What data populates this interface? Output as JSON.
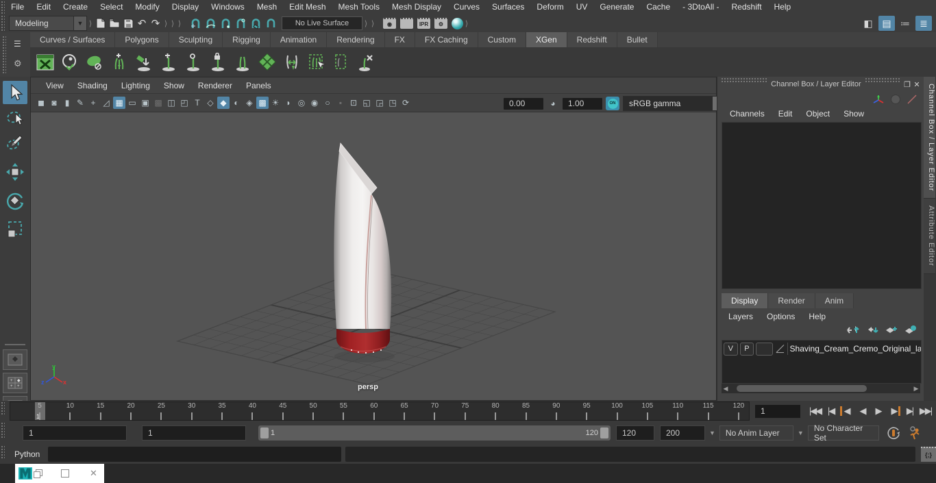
{
  "menubar": {
    "items": [
      "File",
      "Edit",
      "Create",
      "Select",
      "Modify",
      "Display",
      "Windows",
      "Mesh",
      "Edit Mesh",
      "Mesh Tools",
      "Mesh Display",
      "Curves",
      "Surfaces",
      "Deform",
      "UV",
      "Generate",
      "Cache",
      "- 3DtoAll -",
      "Redshift",
      "Help"
    ]
  },
  "statusline": {
    "mode": "Modeling",
    "live_surface": "No Live Surface",
    "undo_glyph": "↶",
    "redo_glyph": "↷",
    "collapse_glyph": "⟩",
    "ipr_label": "IPR",
    "workspace_buttons": [
      {
        "name": "modeling-toolkit-toggle-button",
        "g": "◧"
      },
      {
        "name": "attribute-editor-toggle-button",
        "g": "▤",
        "active": true
      },
      {
        "name": "tool-settings-toggle-button",
        "g": "≔"
      },
      {
        "name": "channel-box-toggle-button",
        "g": "≣",
        "active": true
      }
    ]
  },
  "shelf": {
    "tabs": [
      {
        "label": "Curves / Surfaces",
        "name": "shelf-tab-curves-surfaces"
      },
      {
        "label": "Polygons",
        "name": "shelf-tab-polygons"
      },
      {
        "label": "Sculpting",
        "name": "shelf-tab-sculpting"
      },
      {
        "label": "Rigging",
        "name": "shelf-tab-rigging"
      },
      {
        "label": "Animation",
        "name": "shelf-tab-animation"
      },
      {
        "label": "Rendering",
        "name": "shelf-tab-rendering"
      },
      {
        "label": "FX",
        "name": "shelf-tab-fx"
      },
      {
        "label": "FX Caching",
        "name": "shelf-tab-fx-caching"
      },
      {
        "label": "Custom",
        "name": "shelf-tab-custom"
      },
      {
        "label": "XGen",
        "name": "shelf-tab-xgen",
        "active": true
      },
      {
        "label": "Redshift",
        "name": "shelf-tab-redshift"
      },
      {
        "label": "Bullet",
        "name": "shelf-tab-bullet"
      }
    ]
  },
  "viewport": {
    "menus": [
      "View",
      "Shading",
      "Lighting",
      "Show",
      "Renderer",
      "Panels"
    ],
    "tools": [
      {
        "name": "select-camera-icon",
        "g": "◼"
      },
      {
        "name": "camera-attributes-icon",
        "g": "◙"
      },
      {
        "name": "bookmark-icon",
        "g": "▮"
      },
      {
        "name": "grease-pencil-icon",
        "g": "✎"
      },
      {
        "name": "pan-zoom-icon",
        "g": "+"
      },
      {
        "name": "image-plane-icon",
        "g": "◿"
      },
      {
        "name": "grid-toggle-icon",
        "g": "▦",
        "active": true
      },
      {
        "name": "film-gate-icon",
        "g": "▭"
      },
      {
        "name": "resolution-gate-icon",
        "g": "▣"
      },
      {
        "name": "gate-mask-icon",
        "g": "▩",
        "cls": "dim"
      },
      {
        "name": "field-chart-icon",
        "g": "◫"
      },
      {
        "name": "safe-action-icon",
        "g": "◰"
      },
      {
        "name": "safe-title-icon",
        "g": "T"
      },
      {
        "name": "wireframe-icon",
        "g": "◇"
      },
      {
        "name": "shaded-icon",
        "g": "◆",
        "active": true
      },
      {
        "name": "flat-shade-icon",
        "g": "◐"
      },
      {
        "name": "wireframe-on-shaded-icon",
        "g": "◈"
      },
      {
        "name": "textured-icon",
        "g": "▩",
        "active": true
      },
      {
        "name": "use-lights-icon",
        "g": "☀"
      },
      {
        "name": "shadows-icon",
        "g": "◗"
      },
      {
        "name": "occlusion-icon",
        "g": "◎"
      },
      {
        "name": "motion-blur-icon",
        "g": "◉"
      },
      {
        "name": "anti-alias-icon",
        "g": "○"
      },
      {
        "name": "image-plate-icon",
        "g": "▪",
        "cls": "dim"
      },
      {
        "name": "isolate-select-icon",
        "g": "⊡"
      },
      {
        "name": "xray-icon",
        "g": "◱"
      },
      {
        "name": "xray-joints-icon",
        "g": "◲"
      },
      {
        "name": "snapshot-icon",
        "g": "◳"
      },
      {
        "name": "refresh-icon",
        "g": "⟳"
      }
    ],
    "exposure": "0.00",
    "gamma": "1.00",
    "on_label": "ON",
    "view_transform": "sRGB gamma",
    "camera_label": "persp"
  },
  "channel_box": {
    "title": "Channel Box / Layer Editor",
    "menus": [
      "Channels",
      "Edit",
      "Object",
      "Show"
    ]
  },
  "layer_editor": {
    "tabs": [
      {
        "label": "Display",
        "name": "layer-tab-display",
        "active": true
      },
      {
        "label": "Render",
        "name": "layer-tab-render"
      },
      {
        "label": "Anim",
        "name": "layer-tab-anim"
      }
    ],
    "menus": [
      "Layers",
      "Options",
      "Help"
    ],
    "layer": {
      "visible": "V",
      "playback": "P",
      "name": "Shaving_Cream_Cremo_Original_laye"
    }
  },
  "side_tabs": [
    {
      "label": "Channel Box / Layer Editor",
      "name": "side-tab-channel-box",
      "active": true
    },
    {
      "label": "Attribute Editor",
      "name": "side-tab-attribute-editor"
    }
  ],
  "timeline": {
    "ticks": [
      "5",
      "10",
      "15",
      "20",
      "25",
      "30",
      "35",
      "40",
      "45",
      "50",
      "55",
      "60",
      "65",
      "70",
      "75",
      "80",
      "85",
      "90",
      "95",
      "100",
      "105",
      "110",
      "115",
      "120"
    ],
    "playhead": "1",
    "current_frame": "1",
    "playback": [
      {
        "name": "go-to-start-button",
        "g": "⏴⏴",
        "t": "|◀◀"
      },
      {
        "name": "step-back-frame-button",
        "t": "|◀"
      },
      {
        "name": "step-back-key-button",
        "t": "◀",
        "cls": "keyL"
      },
      {
        "name": "play-backwards-button",
        "t": "◀"
      },
      {
        "name": "play-forwards-button",
        "t": "▶"
      },
      {
        "name": "step-forward-key-button",
        "t": "▶",
        "cls": "keyR"
      },
      {
        "name": "step-forward-frame-button",
        "t": "▶|"
      },
      {
        "name": "go-to-end-button",
        "t": "▶▶|"
      }
    ]
  },
  "range": {
    "anim_start": "1",
    "playback_start": "1",
    "bar_start": "1",
    "bar_end": "120",
    "playback_end": "120",
    "anim_end": "200",
    "anim_layer": "No Anim Layer",
    "character_set": "No Character Set"
  },
  "command_line": {
    "label": "Python",
    "script_editor_glyph": "{;}"
  },
  "colors": {
    "accent_blue": "#5285a6",
    "teal": "#3fb0b4",
    "orange": "#cd7c2e",
    "xgen_green": "#62b357",
    "cap_red": "#a32424"
  }
}
